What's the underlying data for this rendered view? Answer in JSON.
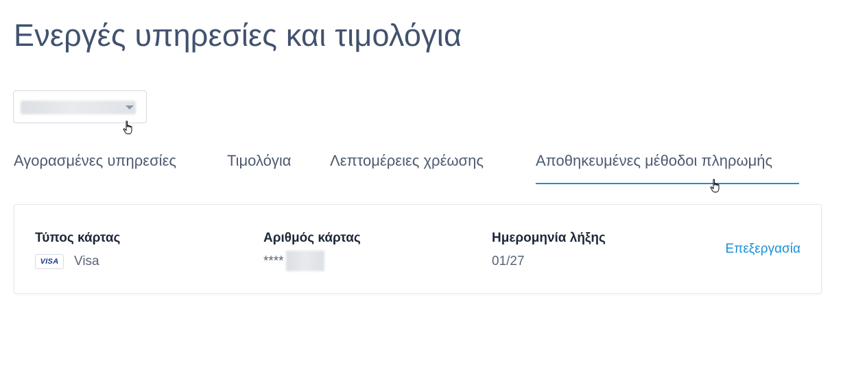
{
  "page": {
    "title": "Ενεργές υπηρεσίες και τιμολόγια"
  },
  "account_selector": {
    "selected_value": ""
  },
  "tabs": [
    {
      "label": "Αγορασμένες υπηρεσίες",
      "active": false
    },
    {
      "label": "Τιμολόγια",
      "active": false
    },
    {
      "label": "Λεπτομέρειες χρέωσης",
      "active": false
    },
    {
      "label": "Αποθηκευμένες μέθοδοι πληρωμής",
      "active": true
    }
  ],
  "payment_method": {
    "card_type_label": "Τύπος κάρτας",
    "card_brand_badge": "VISA",
    "card_type_value": "Visa",
    "card_number_label": "Αριθμός κάρτας",
    "card_number_value": "****",
    "expiry_label": "Ημερομηνία λήξης",
    "expiry_value": "01/27",
    "edit_label": "Επεξεργασία"
  },
  "colors": {
    "title": "#42526e",
    "accent": "#1a8fd9",
    "label": "#1d2838",
    "muted": "#5a6474"
  },
  "icons": {
    "dropdown": "chevron-down-icon",
    "cursor": "hand-pointer-icon"
  }
}
